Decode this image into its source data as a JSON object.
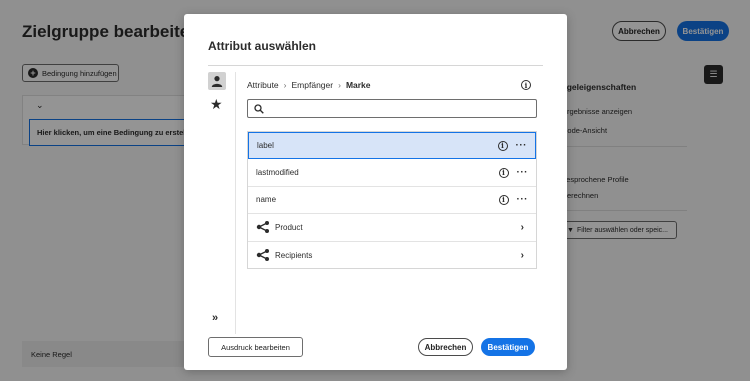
{
  "background": {
    "title": "Zielgruppe bearbeiten",
    "cancel_label": "Abbrechen",
    "confirm_label": "Bestätigen",
    "add_condition_label": "Bedingung hinzufügen",
    "click_hint": "Hier klicken, um eine Bedingung zu erstellen",
    "no_rule": "Keine Regel",
    "right_panel": {
      "heading": "egeleigenschaften",
      "show_results": "Ergebnisse anzeigen",
      "code_view": "Code-Ansicht",
      "profiles": "gesprochene Profile",
      "calculate": "Berechnen",
      "filter_label": "Filter auswählen oder speic..."
    }
  },
  "modal": {
    "title": "Attribut auswählen",
    "breadcrumb": [
      "Attribute",
      "Empfänger",
      "Marke"
    ],
    "search_placeholder": "",
    "items": [
      {
        "label": "label",
        "type": "attribute",
        "selected": true
      },
      {
        "label": "lastmodified",
        "type": "attribute",
        "selected": false
      },
      {
        "label": "name",
        "type": "attribute",
        "selected": false
      },
      {
        "label": "Product",
        "type": "link",
        "selected": false
      },
      {
        "label": "Recipients",
        "type": "link",
        "selected": false
      }
    ],
    "edit_expression_label": "Ausdruck bearbeiten",
    "cancel_label": "Abbrechen",
    "confirm_label": "Bestätigen"
  },
  "colors": {
    "accent": "#1473e6",
    "selected_row": "#d7e4f8"
  },
  "icons": [
    "person-icon",
    "star-icon",
    "expand-icon",
    "info-icon",
    "search-icon",
    "more-icon",
    "link-icon",
    "chevron-right-icon"
  ]
}
